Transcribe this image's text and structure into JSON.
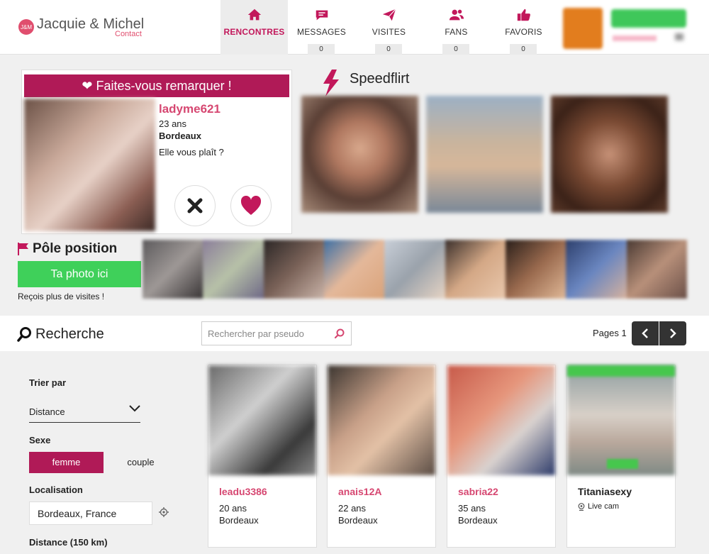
{
  "brand": {
    "badge": "J&M",
    "name": "Jacquie & Michel",
    "sub": "Contact"
  },
  "nav": [
    {
      "label": "RENCONTRES",
      "icon": "home-icon",
      "count": null
    },
    {
      "label": "MESSAGES",
      "icon": "chat-icon",
      "count": "0"
    },
    {
      "label": "VISITES",
      "icon": "paper-plane-icon",
      "count": "0"
    },
    {
      "label": "FANS",
      "icon": "users-icon",
      "count": "0"
    },
    {
      "label": "FAVORIS",
      "icon": "thumbs-up-icon",
      "count": "0"
    }
  ],
  "featured": {
    "banner": "Faites-vous remarquer !",
    "name": "ladyme621",
    "age": "23 ans",
    "city": "Bordeaux",
    "question": "Elle vous plaît ?"
  },
  "speedflirt": {
    "title": "Speedflirt"
  },
  "pole": {
    "title": "Pôle position",
    "button": "Ta photo ici",
    "sub": "Reçois plus de visites !"
  },
  "search": {
    "title": "Recherche",
    "placeholder": "Rechercher par pseudo",
    "pages_label": "Pages 1"
  },
  "filters": {
    "sort_label": "Trier par",
    "sort_value": "Distance",
    "sex_label": "Sexe",
    "sex_options": [
      "femme",
      "couple"
    ],
    "loc_label": "Localisation",
    "loc_value": "Bordeaux, France",
    "distance_label": "Distance (150 km)"
  },
  "profiles": [
    {
      "name": "leadu3386",
      "age": "20 ans",
      "city": "Bordeaux"
    },
    {
      "name": "anais12A",
      "age": "22 ans",
      "city": "Bordeaux"
    },
    {
      "name": "sabria22",
      "age": "35 ans",
      "city": "Bordeaux"
    },
    {
      "name": "Titaniasexy",
      "cam": "Live cam"
    }
  ],
  "colors": {
    "accent": "#b01a57",
    "pink": "#d64771",
    "green": "#3fd05a"
  }
}
